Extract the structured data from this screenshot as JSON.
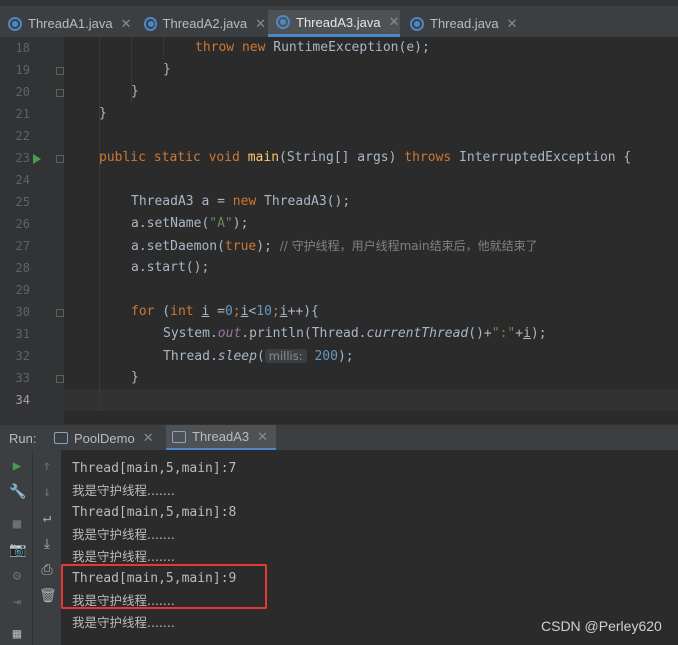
{
  "tabs": [
    {
      "label": "ThreadA1.java",
      "active": false
    },
    {
      "label": "ThreadA2.java",
      "active": false
    },
    {
      "label": "ThreadA3.java",
      "active": true
    },
    {
      "label": "Thread.java",
      "active": false
    }
  ],
  "editor": {
    "line_numbers": [
      "18",
      "19",
      "20",
      "21",
      "22",
      "23",
      "24",
      "25",
      "26",
      "27",
      "28",
      "29",
      "30",
      "31",
      "32",
      "33",
      "34"
    ],
    "code": {
      "l18_throw": "throw",
      "l18_new": "new",
      "l18_rest": " RuntimeException(e);",
      "l19": "}",
      "l20": "}",
      "l21": "}",
      "l23_kw": "public static void",
      "l23_fn": "main",
      "l23_params": "(String[] args) ",
      "l23_throws": "throws",
      "l23_ex": " InterruptedException {",
      "l25_a": "ThreadA3 a = ",
      "l25_new": "new",
      "l25_b": " ThreadA3();",
      "l26_a": "a.setName(",
      "l26_str": "\"A\"",
      "l26_b": ");",
      "l27_a": "a.setDaemon(",
      "l27_true": "true",
      "l27_b": "); ",
      "l27_comment": "// 守护线程，用户线程main结束后，他就结束了",
      "l28": "a.start();",
      "l30_for": "for",
      "l30_a": " (",
      "l30_int": "int",
      "l30_i": "i",
      "l30_b": " =",
      "l30_zero": "0",
      "l30_c": ";",
      "l30_i2": "i",
      "l30_d": "<",
      "l30_ten": "10",
      "l30_e": ";",
      "l30_i3": "i",
      "l30_f": "++){",
      "l31_a": "System.",
      "l31_out": "out",
      "l31_b": ".println(Thread.",
      "l31_ct": "currentThread",
      "l31_c": "()+",
      "l31_str": "\":\"",
      "l31_d": "+",
      "l31_i": "i",
      "l31_e": ");",
      "l32_a": "Thread.",
      "l32_sleep": "sleep",
      "l32_b": "(",
      "l32_hint": "millis:",
      "l32_num": "200",
      "l32_c": ");",
      "l33": "}"
    }
  },
  "run": {
    "label": "Run:",
    "tabs": [
      {
        "label": "PoolDemo",
        "active": false
      },
      {
        "label": "ThreadA3",
        "active": true
      }
    ]
  },
  "console": {
    "lines": [
      "Thread[main,5,main]:7",
      "我是守护线程.......",
      "Thread[main,5,main]:8",
      "我是守护线程.......",
      "我是守护线程.......",
      "Thread[main,5,main]:9",
      "我是守护线程.......",
      "我是守护线程......."
    ]
  },
  "watermark": "CSDN @Perley620",
  "colors": {
    "highlight_box": "#e53935",
    "keyword": "#cc7832",
    "string": "#6a8759",
    "number": "#6897bb",
    "method_decl": "#ffc66d",
    "static_field": "#9876aa"
  }
}
